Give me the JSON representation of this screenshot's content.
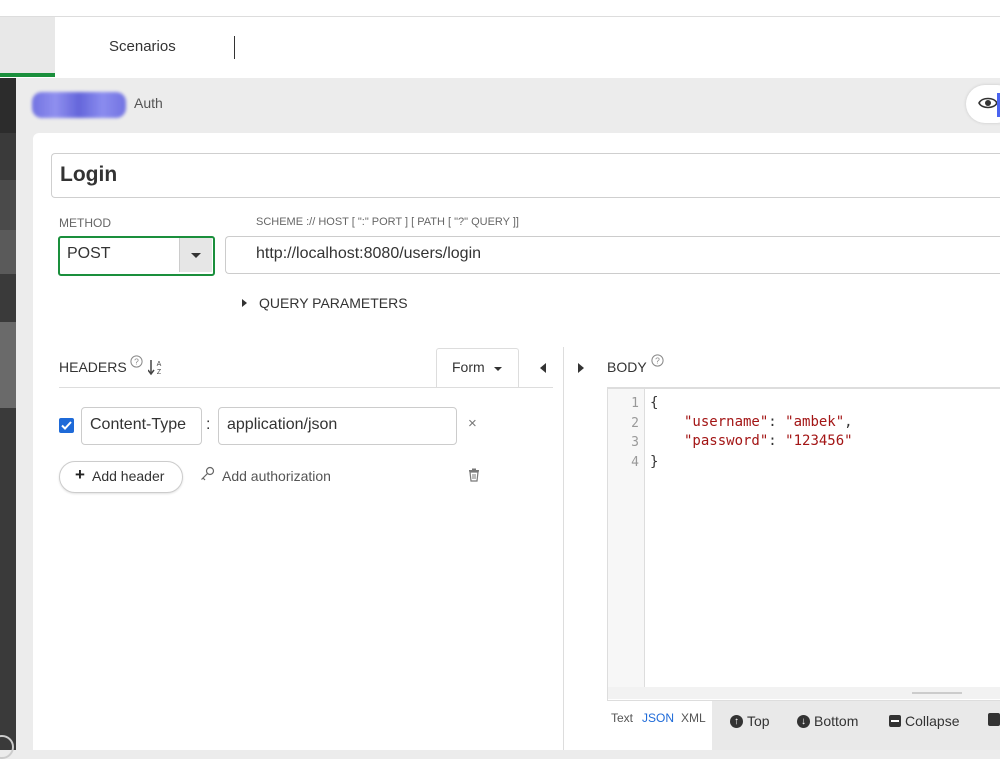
{
  "tabs": {
    "scenarios_label": "Scenarios"
  },
  "breadcrumb": {
    "current": "Auth"
  },
  "request": {
    "title": "Login",
    "method_label": "METHOD",
    "method_value": "POST",
    "scheme_label": "SCHEME :// HOST [ \":\" PORT ] [ PATH [ \"?\" QUERY ]]",
    "url": "http://localhost:8080/users/login",
    "query_parameters_label": "QUERY PARAMETERS"
  },
  "headers": {
    "label": "HEADERS",
    "help_icon": "?",
    "sort_icon": "↓A/Z",
    "form_label": "Form",
    "rows": [
      {
        "enabled": true,
        "key": "Content-Type",
        "value": "application/json",
        "remove": "×"
      }
    ],
    "add_header_label": "Add header",
    "add_header_plus": "+",
    "add_authorization_label": "Add authorization"
  },
  "body": {
    "label": "BODY",
    "help_icon": "?",
    "line_numbers": [
      "1",
      "2",
      "3",
      "4"
    ],
    "code": {
      "line1": "{",
      "line2_key": "\"username\"",
      "line2_sep": ": ",
      "line2_val": "\"ambek\"",
      "line2_end": ",",
      "line3_key": "\"password\"",
      "line3_sep": ": ",
      "line3_val": "\"123456\"",
      "line4": "}"
    },
    "formats": {
      "text": "Text",
      "json": "JSON",
      "xml": "XML",
      "active": "JSON"
    },
    "footer_buttons": {
      "top": "Top",
      "bottom": "Bottom",
      "collapse": "Collapse"
    }
  },
  "icons": [
    "eye-icon",
    "caret-down-icon",
    "caret-right-icon",
    "caret-left-icon",
    "help-icon",
    "sort-alpha-icon",
    "checkbox-checked-icon",
    "close-icon",
    "plus-icon",
    "key-icon",
    "trash-icon",
    "arrow-up-circle-icon",
    "arrow-down-circle-icon",
    "minus-square-icon"
  ],
  "colors": {
    "accent_green": "#1a8f3c",
    "link_blue": "#1e6ad8",
    "json_string": "#a31515"
  }
}
